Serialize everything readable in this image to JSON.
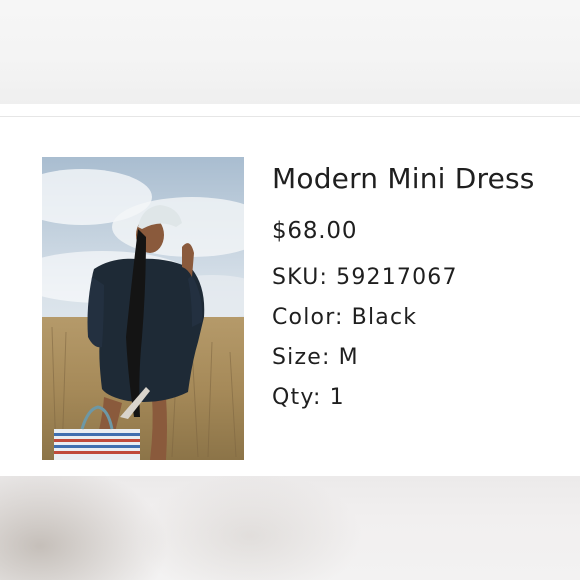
{
  "product": {
    "name": "Modern Mini Dress",
    "price": "$68.00",
    "attributes": [
      {
        "label": "SKU:",
        "value": "59217067"
      },
      {
        "label": "Color:",
        "value": "Black"
      },
      {
        "label": "Size:",
        "value": "M"
      },
      {
        "label": "Qty:",
        "value": "1"
      }
    ]
  }
}
